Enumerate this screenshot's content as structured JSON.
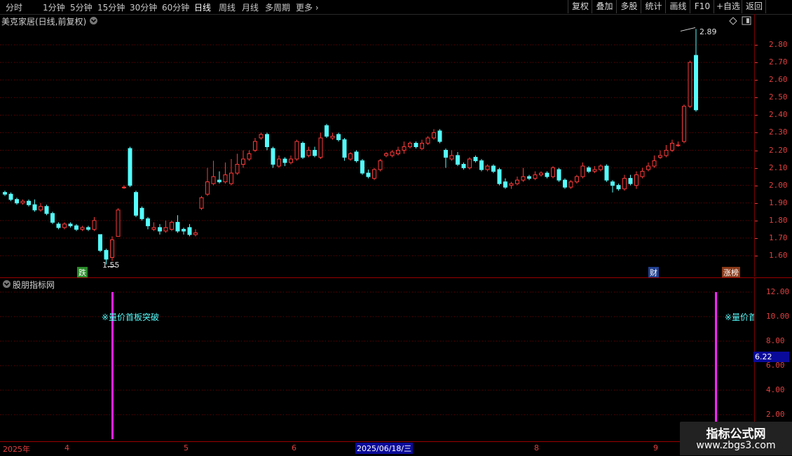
{
  "toolbar": {
    "periods": [
      "分时",
      "1分钟",
      "5分钟",
      "15分钟",
      "30分钟",
      "60分钟",
      "日线",
      "周线",
      "月线",
      "多周期",
      "更多"
    ],
    "active_period": "日线",
    "right_buttons": [
      "复权",
      "叠加",
      "多股",
      "统计",
      "画线",
      "F10",
      "+自选",
      "返回"
    ]
  },
  "main_chart": {
    "title": "美克家居(日线,前复权)",
    "price_ticks": [
      "2.80",
      "2.70",
      "2.60",
      "2.50",
      "2.40",
      "2.30",
      "2.20",
      "2.10",
      "2.00",
      "1.90",
      "1.80",
      "1.70",
      "1.60"
    ],
    "high_label": "2.89",
    "low_label": "1.55",
    "markers": [
      {
        "text": "跌",
        "color": "#2a8a2a"
      },
      {
        "text": "财",
        "color": "#1f3f8f"
      },
      {
        "text": "涨榜",
        "color": "#8a3a1a"
      }
    ],
    "colors": {
      "up": "#ff3a3a",
      "down": "#54fcfc",
      "grid": "#7a0000"
    }
  },
  "indicator": {
    "title": "股朋指标网",
    "ticks": [
      "12.00",
      "10.00",
      "8.00",
      "6.00",
      "4.00",
      "2.00"
    ],
    "current_value": "6.22",
    "signal_label": "※量价首板突破",
    "signal_label_cut": "※量价首",
    "signal_color": "#ff22ff"
  },
  "time_axis": {
    "labels": [
      "2025年",
      "4",
      "5",
      "6",
      "8",
      "9"
    ],
    "cursor_date": "2025/06/18/三"
  },
  "watermark": {
    "line1": "指标公式网",
    "line2": "www.zbgs3.com"
  },
  "chart_data": {
    "type": "candlestick",
    "title": "美克家居(日线,前复权)",
    "ylim": [
      1.55,
      2.9
    ],
    "y_ticks": [
      1.6,
      1.7,
      1.8,
      1.9,
      2.0,
      2.1,
      2.2,
      2.3,
      2.4,
      2.5,
      2.6,
      2.7,
      2.8
    ],
    "x_labels": [
      "4",
      "5",
      "6",
      "8",
      "9"
    ],
    "high": 2.89,
    "low": 1.55,
    "candles": [
      [
        1.96,
        1.95,
        1.97,
        1.94
      ],
      [
        1.95,
        1.92,
        1.96,
        1.91
      ],
      [
        1.92,
        1.9,
        1.93,
        1.89
      ],
      [
        1.9,
        1.91,
        1.92,
        1.89
      ],
      [
        1.91,
        1.89,
        1.92,
        1.88
      ],
      [
        1.89,
        1.86,
        1.92,
        1.85
      ],
      [
        1.86,
        1.88,
        1.9,
        1.85
      ],
      [
        1.88,
        1.84,
        1.89,
        1.83
      ],
      [
        1.84,
        1.79,
        1.85,
        1.78
      ],
      [
        1.78,
        1.76,
        1.79,
        1.75
      ],
      [
        1.76,
        1.78,
        1.79,
        1.75
      ],
      [
        1.78,
        1.77,
        1.79,
        1.76
      ],
      [
        1.77,
        1.75,
        1.78,
        1.74
      ],
      [
        1.75,
        1.76,
        1.77,
        1.74
      ],
      [
        1.76,
        1.75,
        1.77,
        1.74
      ],
      [
        1.75,
        1.8,
        1.82,
        1.74
      ],
      [
        1.72,
        1.63,
        1.72,
        1.62
      ],
      [
        1.63,
        1.58,
        1.64,
        1.55
      ],
      [
        1.59,
        1.69,
        1.71,
        1.57
      ],
      [
        1.71,
        1.86,
        1.87,
        1.71
      ],
      [
        1.99,
        1.99,
        2.0,
        1.98
      ],
      [
        2.21,
        2.0,
        2.22,
        1.99
      ],
      [
        1.96,
        1.83,
        1.97,
        1.82
      ],
      [
        1.87,
        1.81,
        1.88,
        1.8
      ],
      [
        1.81,
        1.77,
        1.82,
        1.75
      ],
      [
        1.75,
        1.76,
        1.79,
        1.74
      ],
      [
        1.76,
        1.74,
        1.78,
        1.72
      ],
      [
        1.74,
        1.76,
        1.8,
        1.73
      ],
      [
        1.75,
        1.79,
        1.8,
        1.74
      ],
      [
        1.79,
        1.74,
        1.83,
        1.73
      ],
      [
        1.75,
        1.74,
        1.76,
        1.72
      ],
      [
        1.76,
        1.72,
        1.78,
        1.71
      ],
      [
        1.72,
        1.73,
        1.75,
        1.71
      ],
      [
        1.87,
        1.93,
        1.94,
        1.86
      ],
      [
        1.95,
        2.02,
        2.1,
        1.94
      ],
      [
        2.01,
        2.05,
        2.14,
        2.0
      ],
      [
        2.03,
        2.02,
        2.08,
        2.01
      ],
      [
        2.02,
        2.06,
        2.13,
        2.01
      ],
      [
        2.01,
        2.07,
        2.15,
        2.0
      ],
      [
        2.07,
        2.12,
        2.18,
        2.06
      ],
      [
        2.12,
        2.15,
        2.2,
        2.1
      ],
      [
        2.15,
        2.18,
        2.2,
        2.14
      ],
      [
        2.2,
        2.25,
        2.27,
        2.19
      ],
      [
        2.27,
        2.29,
        2.3,
        2.26
      ],
      [
        2.29,
        2.22,
        2.3,
        2.2
      ],
      [
        2.21,
        2.12,
        2.22,
        2.1
      ],
      [
        2.11,
        2.15,
        2.17,
        2.1
      ],
      [
        2.15,
        2.13,
        2.16,
        2.11
      ],
      [
        2.13,
        2.15,
        2.17,
        2.12
      ],
      [
        2.15,
        2.25,
        2.26,
        2.14
      ],
      [
        2.24,
        2.16,
        2.25,
        2.15
      ],
      [
        2.17,
        2.2,
        2.22,
        2.16
      ],
      [
        2.2,
        2.17,
        2.22,
        2.16
      ],
      [
        2.16,
        2.27,
        2.3,
        2.15
      ],
      [
        2.34,
        2.28,
        2.35,
        2.27
      ],
      [
        2.27,
        2.28,
        2.3,
        2.26
      ],
      [
        2.29,
        2.26,
        2.3,
        2.25
      ],
      [
        2.26,
        2.16,
        2.27,
        2.14
      ],
      [
        2.15,
        2.18,
        2.19,
        2.14
      ],
      [
        2.19,
        2.14,
        2.2,
        2.13
      ],
      [
        2.14,
        2.07,
        2.15,
        2.06
      ],
      [
        2.07,
        2.05,
        2.09,
        2.04
      ],
      [
        2.04,
        2.09,
        2.1,
        2.03
      ],
      [
        2.09,
        2.14,
        2.15,
        2.08
      ],
      [
        2.17,
        2.18,
        2.19,
        2.16
      ],
      [
        2.17,
        2.19,
        2.2,
        2.16
      ],
      [
        2.18,
        2.2,
        2.22,
        2.17
      ],
      [
        2.2,
        2.22,
        2.25,
        2.18
      ],
      [
        2.22,
        2.24,
        2.25,
        2.21
      ],
      [
        2.24,
        2.22,
        2.25,
        2.21
      ],
      [
        2.21,
        2.24,
        2.26,
        2.2
      ],
      [
        2.24,
        2.27,
        2.28,
        2.23
      ],
      [
        2.27,
        2.3,
        2.32,
        2.26
      ],
      [
        2.31,
        2.25,
        2.32,
        2.24
      ],
      [
        2.2,
        2.16,
        2.21,
        2.1
      ],
      [
        2.15,
        2.17,
        2.2,
        2.14
      ],
      [
        2.17,
        2.12,
        2.19,
        2.11
      ],
      [
        2.12,
        2.1,
        2.13,
        2.09
      ],
      [
        2.1,
        2.15,
        2.16,
        2.09
      ],
      [
        2.16,
        2.14,
        2.17,
        2.13
      ],
      [
        2.14,
        2.09,
        2.15,
        2.08
      ],
      [
        2.09,
        2.11,
        2.12,
        2.08
      ],
      [
        2.11,
        2.08,
        2.12,
        2.07
      ],
      [
        2.09,
        2.01,
        2.1,
        2.0
      ],
      [
        2.02,
        1.99,
        2.04,
        1.98
      ],
      [
        2.0,
        2.01,
        2.02,
        1.98
      ],
      [
        2.01,
        2.03,
        2.05,
        2.0
      ],
      [
        2.03,
        2.05,
        2.1,
        2.02
      ],
      [
        2.05,
        2.04,
        2.06,
        2.03
      ],
      [
        2.04,
        2.06,
        2.08,
        2.03
      ],
      [
        2.06,
        2.07,
        2.08,
        2.05
      ],
      [
        2.07,
        2.05,
        2.08,
        2.04
      ],
      [
        2.05,
        2.1,
        2.11,
        2.04
      ],
      [
        2.09,
        2.03,
        2.1,
        2.02
      ],
      [
        2.03,
        1.99,
        2.04,
        1.98
      ],
      [
        1.99,
        2.02,
        2.03,
        1.98
      ],
      [
        2.02,
        2.05,
        2.06,
        2.01
      ],
      [
        2.05,
        2.11,
        2.13,
        2.04
      ],
      [
        2.1,
        2.08,
        2.11,
        2.07
      ],
      [
        2.08,
        2.09,
        2.11,
        2.07
      ],
      [
        2.09,
        2.11,
        2.12,
        2.08
      ],
      [
        2.11,
        2.03,
        2.12,
        2.02
      ],
      [
        2.02,
        2.0,
        2.03,
        1.96
      ],
      [
        2.0,
        1.98,
        2.01,
        1.97
      ],
      [
        1.98,
        2.04,
        2.06,
        1.97
      ],
      [
        2.04,
        2.01,
        2.06,
        2.0
      ],
      [
        2.0,
        2.06,
        2.08,
        1.98
      ],
      [
        2.05,
        2.08,
        2.1,
        2.04
      ],
      [
        2.09,
        2.11,
        2.13,
        2.08
      ],
      [
        2.11,
        2.14,
        2.17,
        2.1
      ],
      [
        2.16,
        2.17,
        2.2,
        2.15
      ],
      [
        2.17,
        2.2,
        2.23,
        2.16
      ],
      [
        2.2,
        2.24,
        2.26,
        2.19
      ],
      [
        2.23,
        2.23,
        2.25,
        2.22
      ],
      [
        2.25,
        2.45,
        2.46,
        2.24
      ],
      [
        2.45,
        2.7,
        2.71,
        2.44
      ],
      [
        2.74,
        2.43,
        2.89,
        2.42
      ]
    ]
  },
  "indicator_chart_data": {
    "type": "bar",
    "ylim": [
      0,
      12.0
    ],
    "signals": [
      {
        "index": 19,
        "value": 12.0
      },
      {
        "index": 119,
        "value": 12.0
      }
    ]
  }
}
